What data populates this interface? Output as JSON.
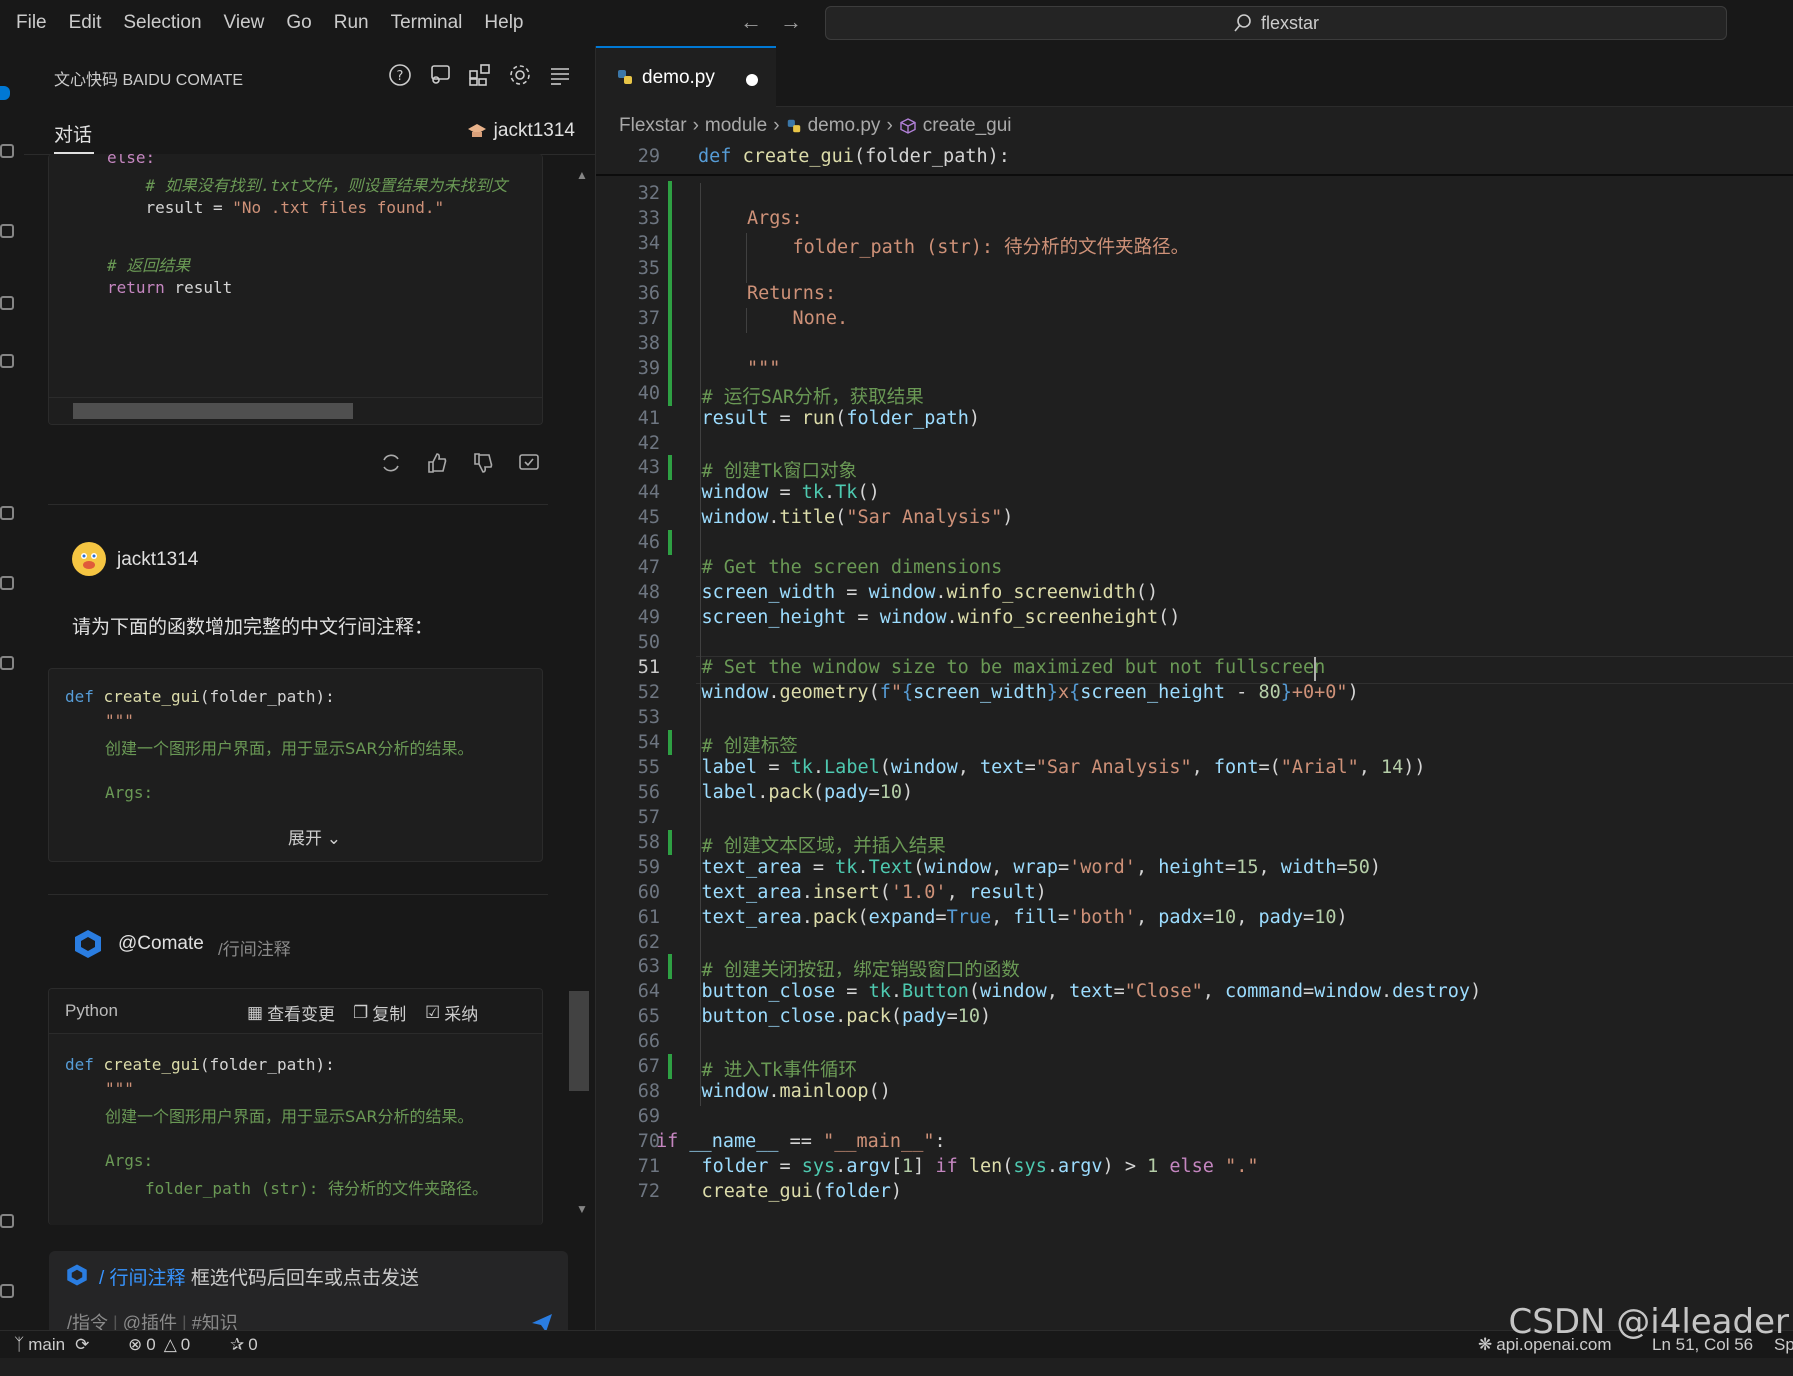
{
  "menu": [
    "File",
    "Edit",
    "Selection",
    "View",
    "Go",
    "Run",
    "Terminal",
    "Help"
  ],
  "search": {
    "text": "flexstar"
  },
  "sidebar": {
    "title": "文心快码 BAIDU COMATE",
    "tab_chat": "对话",
    "user": "jackt1314",
    "top_code": {
      "line1": "else:",
      "line2": "    # 如果没有找到.txt文件，则设置结果为未找到文",
      "line3_var": "    result",
      "line3_eq": " = ",
      "line3_str": "\"No .txt files found.\"",
      "line4": "# 返回结果",
      "line5_kw": "return",
      "line5_rest": " result"
    },
    "message_user": "jackt1314",
    "message_prompt": "请为下面的函数增加完整的中文行间注释：",
    "user_code": {
      "def": "def",
      "fn": "create_gui",
      "args": "(folder_path):",
      "doc": "\"\"\"",
      "desc": "创建一个图形用户界面，用于显示SAR分析的结果。",
      "argsl": "Args:",
      "expand": "展开"
    },
    "comate_name": "@Comate",
    "comate_cmd": "/行间注释",
    "reply_code": {
      "lang": "Python",
      "view_changes": "查看变更",
      "copy": "复制",
      "adopt": "采纳",
      "def": "def",
      "fn": "create_gui",
      "args": "(folder_path):",
      "doc": "\"\"\"",
      "desc": "创建一个图形用户界面，用于显示SAR分析的结果。",
      "argsl": "Args:",
      "param": "folder_path (str): 待分析的文件夹路径。"
    },
    "input": {
      "cmd": "/ 行间注释",
      "hint": " 框选代码后回车或点击发送",
      "opt1": "/指令",
      "opt2": "@插件",
      "opt3": "#知识"
    }
  },
  "editor": {
    "tab": "demo.py",
    "breadcrumb": [
      "Flexstar",
      "module",
      "demo.py",
      "create_gui"
    ],
    "sticky": {
      "ln": "29",
      "kw": "def",
      "fn": "create_gui",
      "rest": "(folder_path):"
    },
    "lines": [
      {
        "n": "32"
      },
      {
        "n": "33",
        "t": "Args:"
      },
      {
        "n": "34",
        "t": "folder_path (str): 待分析的文件夹路径。"
      },
      {
        "n": "35"
      },
      {
        "n": "36",
        "t": "Returns:"
      },
      {
        "n": "37",
        "t": "None."
      },
      {
        "n": "38"
      },
      {
        "n": "39",
        "t": "\"\"\""
      },
      {
        "n": "40",
        "t": "# 运行SAR分析，获取结果"
      },
      {
        "n": "41"
      },
      {
        "n": "42"
      },
      {
        "n": "43",
        "t": "# 创建Tk窗口对象"
      },
      {
        "n": "44"
      },
      {
        "n": "45"
      },
      {
        "n": "46"
      },
      {
        "n": "47",
        "t": "# Get the screen dimensions"
      },
      {
        "n": "48"
      },
      {
        "n": "49"
      },
      {
        "n": "50"
      },
      {
        "n": "51",
        "t": "# Set the window size to be maximized but not fullscreen"
      },
      {
        "n": "52"
      },
      {
        "n": "53"
      },
      {
        "n": "54",
        "t": "# 创建标签"
      },
      {
        "n": "55"
      },
      {
        "n": "56"
      },
      {
        "n": "57"
      },
      {
        "n": "58",
        "t": "# 创建文本区域，并插入结果"
      },
      {
        "n": "59"
      },
      {
        "n": "60"
      },
      {
        "n": "61"
      },
      {
        "n": "62"
      },
      {
        "n": "63",
        "t": "# 创建关闭按钮，绑定销毁窗口的函数"
      },
      {
        "n": "64"
      },
      {
        "n": "65"
      },
      {
        "n": "66"
      },
      {
        "n": "67",
        "t": "# 进入Tk事件循环"
      },
      {
        "n": "68"
      },
      {
        "n": "69"
      },
      {
        "n": "70"
      },
      {
        "n": "71"
      },
      {
        "n": "72"
      }
    ]
  },
  "status": {
    "branch": "main",
    "errors": "0",
    "warnings": "0",
    "ports": "0",
    "api": "api.openai.com",
    "cursor": "Ln 51, Col 56",
    "extra": "Sp"
  },
  "watermark": "CSDN @i4leader",
  "colors": {
    "accent": "#0078d4",
    "git_added": "#2ea043",
    "background": "#1f1f1f"
  }
}
